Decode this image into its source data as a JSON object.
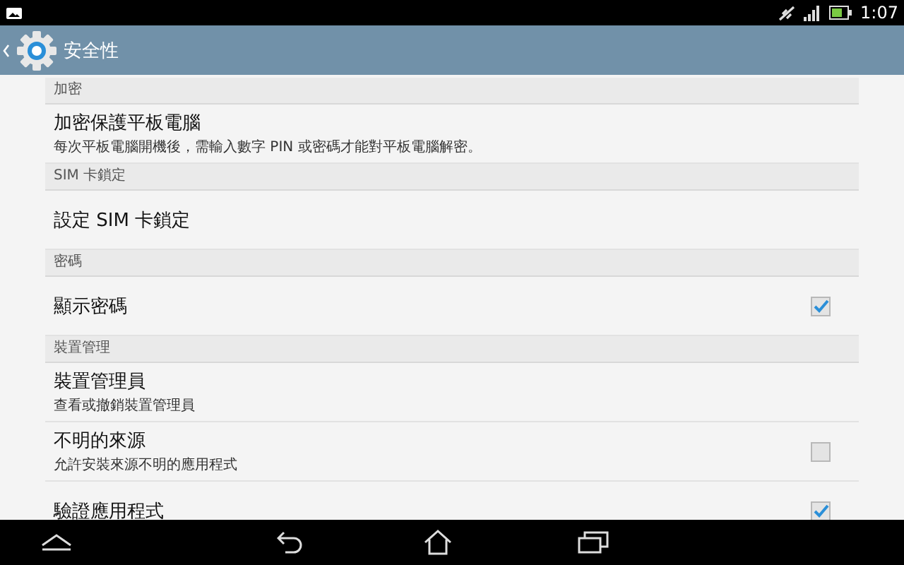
{
  "status_bar": {
    "time": "1:07"
  },
  "action_bar": {
    "title": "安全性"
  },
  "sections": [
    {
      "header": "加密",
      "items": [
        {
          "kind": "text",
          "title": "加密保護平板電腦",
          "summary": "每次平板電腦開機後，需輸入數字 PIN 或密碼才能對平板電腦解密。"
        }
      ]
    },
    {
      "header": "SIM 卡鎖定",
      "items": [
        {
          "kind": "text",
          "title": "設定 SIM 卡鎖定"
        }
      ]
    },
    {
      "header": "密碼",
      "items": [
        {
          "kind": "checkbox",
          "title": "顯示密碼",
          "checked": true
        }
      ]
    },
    {
      "header": "裝置管理",
      "items": [
        {
          "kind": "text",
          "title": "裝置管理員",
          "summary": "查看或撤銷裝置管理員"
        },
        {
          "kind": "checkbox",
          "title": "不明的來源",
          "summary": "允許安裝來源不明的應用程式",
          "checked": false
        },
        {
          "kind": "checkbox",
          "title": "驗證應用程式",
          "checked": true
        }
      ]
    }
  ]
}
